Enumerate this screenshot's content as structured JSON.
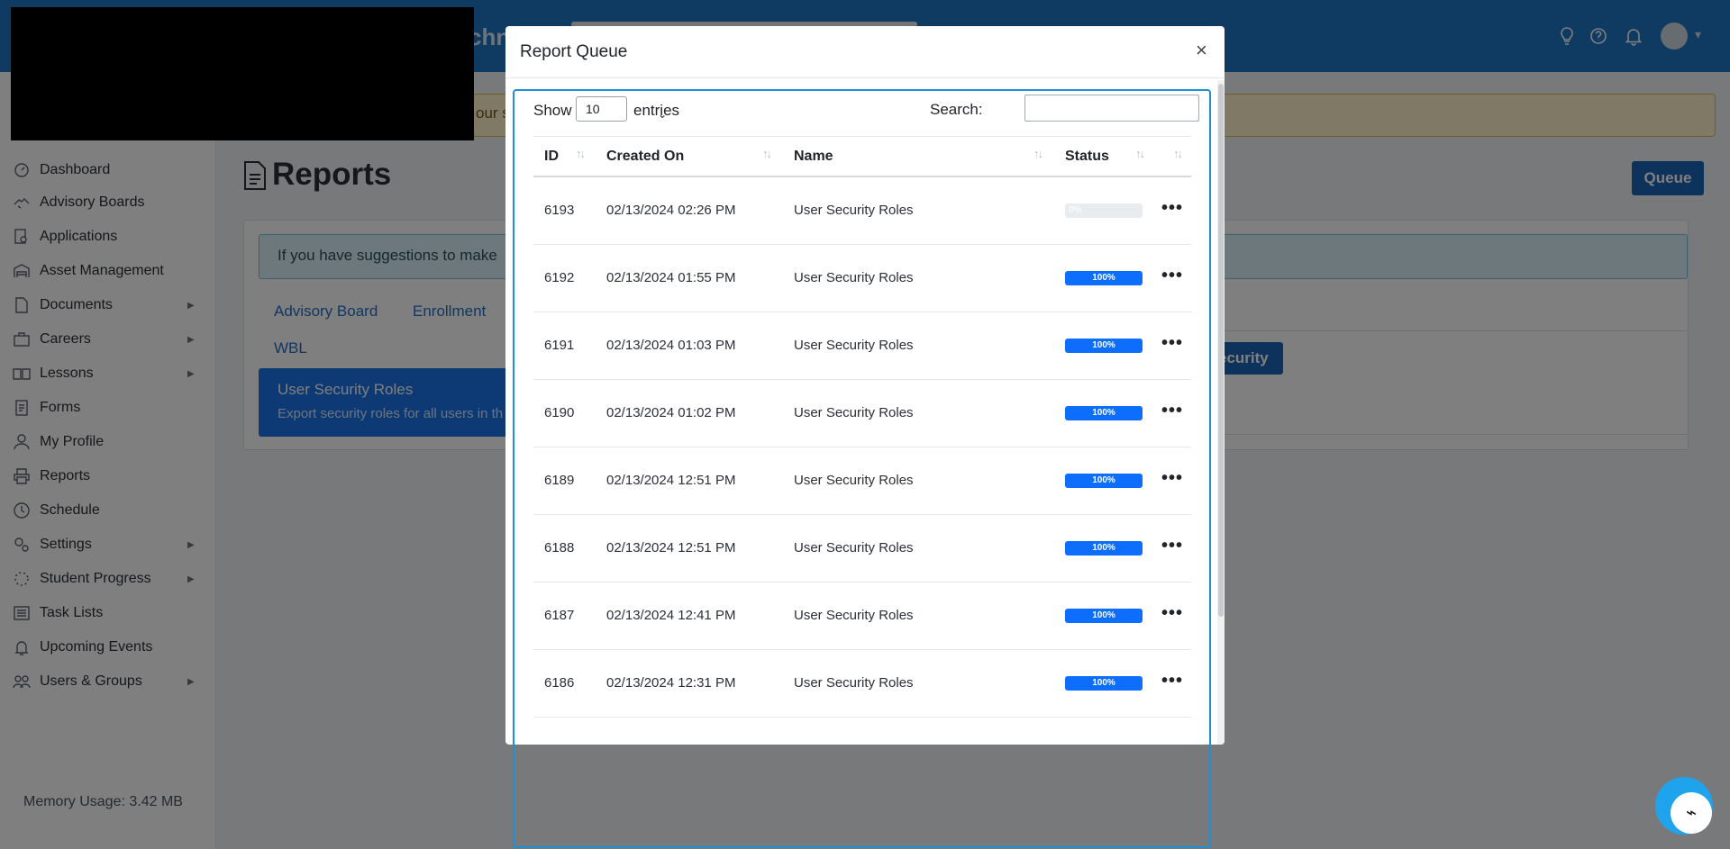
{
  "header": {
    "brand_fragment": "chn",
    "icons": [
      "lightbulb-icon",
      "help-icon",
      "bell-icon",
      "avatar-icon",
      "chevron-down-icon"
    ]
  },
  "alert": {
    "fragment": "our s"
  },
  "sidebar": {
    "items": [
      {
        "label": "Dashboard",
        "icon": "dashboard-icon",
        "has_children": false
      },
      {
        "label": "Advisory Boards",
        "icon": "handshake-icon",
        "has_children": false
      },
      {
        "label": "Applications",
        "icon": "search-doc-icon",
        "has_children": false
      },
      {
        "label": "Asset Management",
        "icon": "warehouse-icon",
        "has_children": false
      },
      {
        "label": "Documents",
        "icon": "document-icon",
        "has_children": true
      },
      {
        "label": "Careers",
        "icon": "briefcase-icon",
        "has_children": true
      },
      {
        "label": "Lessons",
        "icon": "lessons-icon",
        "has_children": true
      },
      {
        "label": "Forms",
        "icon": "form-icon",
        "has_children": false
      },
      {
        "label": "My Profile",
        "icon": "user-icon",
        "has_children": false
      },
      {
        "label": "Reports",
        "icon": "printer-icon",
        "has_children": false
      },
      {
        "label": "Schedule",
        "icon": "clock-icon",
        "has_children": false
      },
      {
        "label": "Settings",
        "icon": "gears-icon",
        "has_children": true
      },
      {
        "label": "Student Progress",
        "icon": "spinner-icon",
        "has_children": true
      },
      {
        "label": "Task Lists",
        "icon": "list-icon",
        "has_children": false
      },
      {
        "label": "Upcoming Events",
        "icon": "bell-icon",
        "has_children": false
      },
      {
        "label": "Users & Groups",
        "icon": "users-icon",
        "has_children": true
      }
    ],
    "memory_usage": "Memory Usage: 3.42 MB"
  },
  "main": {
    "page_title": "Reports",
    "queue_button": "Queue",
    "info_text": "If you have suggestions to make",
    "tabs": [
      "Advisory Board",
      "Enrollment",
      "WBL"
    ],
    "report_card": {
      "title": "User Security Roles",
      "description": "Export security roles for all users in th"
    },
    "security_button_fragment": "ecurity"
  },
  "modal": {
    "title": "Report Queue",
    "close_symbol": "×",
    "show_label": "Show",
    "entries_value": "10",
    "entries_label": "entries",
    "search_label": "Search:",
    "search_value": "",
    "columns": [
      "ID",
      "Created On",
      "Name",
      "Status",
      ""
    ],
    "rows": [
      {
        "id": "6193",
        "created_on": "02/13/2024 02:26 PM",
        "name": "User Security Roles",
        "progress": 0,
        "progress_label": "0%"
      },
      {
        "id": "6192",
        "created_on": "02/13/2024 01:55 PM",
        "name": "User Security Roles",
        "progress": 100,
        "progress_label": "100%"
      },
      {
        "id": "6191",
        "created_on": "02/13/2024 01:03 PM",
        "name": "User Security Roles",
        "progress": 100,
        "progress_label": "100%"
      },
      {
        "id": "6190",
        "created_on": "02/13/2024 01:02 PM",
        "name": "User Security Roles",
        "progress": 100,
        "progress_label": "100%"
      },
      {
        "id": "6189",
        "created_on": "02/13/2024 12:51 PM",
        "name": "User Security Roles",
        "progress": 100,
        "progress_label": "100%"
      },
      {
        "id": "6188",
        "created_on": "02/13/2024 12:51 PM",
        "name": "User Security Roles",
        "progress": 100,
        "progress_label": "100%"
      },
      {
        "id": "6187",
        "created_on": "02/13/2024 12:41 PM",
        "name": "User Security Roles",
        "progress": 100,
        "progress_label": "100%"
      },
      {
        "id": "6186",
        "created_on": "02/13/2024 12:31 PM",
        "name": "User Security Roles",
        "progress": 100,
        "progress_label": "100%"
      }
    ],
    "more_symbol": "•••"
  },
  "colors": {
    "header_blue": "#1f75c4",
    "primary": "#1a66b8",
    "progress": "#0d6efd",
    "highlight_frame": "#1f8fd6"
  }
}
